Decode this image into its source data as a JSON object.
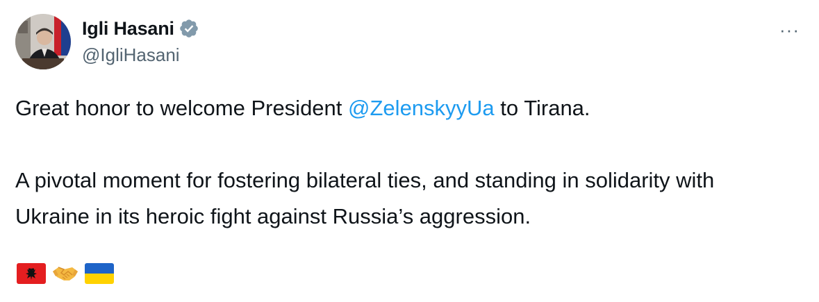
{
  "tweet": {
    "author": {
      "display_name": "Igli Hasani",
      "handle": "@IgliHasani",
      "verified": true
    },
    "more_menu_label": "···",
    "body": {
      "line1_prefix": "Great honor to welcome President ",
      "mention": "@ZelenskyyUa",
      "line1_suffix": " to Tirana.",
      "paragraph2": "A pivotal moment for fostering bilateral ties, and standing in solidarity with Ukraine in its heroic fight against Russia’s aggression."
    },
    "emojis": [
      "albania-flag-emoji",
      "handshake-emoji",
      "ukraine-flag-emoji"
    ],
    "colors": {
      "text": "#0f1419",
      "secondary": "#536471",
      "link": "#1d9bf0",
      "verified_badge": "#829aab"
    }
  }
}
